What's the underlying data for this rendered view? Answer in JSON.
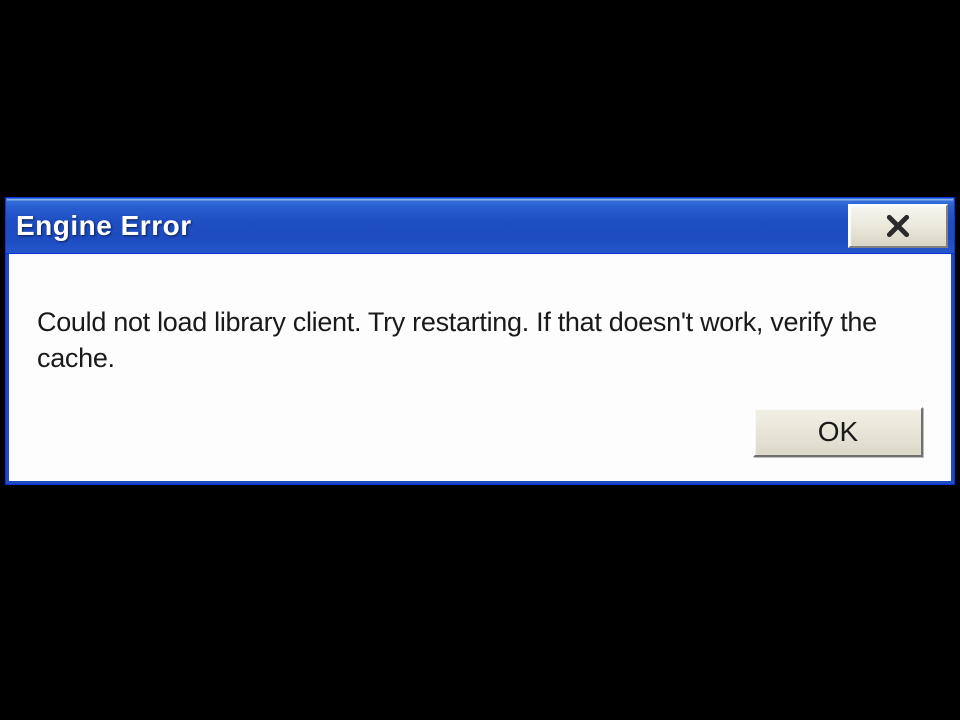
{
  "dialog": {
    "title": "Engine Error",
    "message": "Could not load library client. Try restarting. If that doesn't work, verify the cache.",
    "ok_label": "OK"
  }
}
